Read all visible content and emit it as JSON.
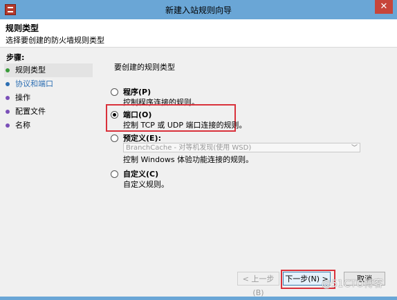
{
  "window": {
    "title": "新建入站规则向导",
    "close_label": "✕"
  },
  "header": {
    "title": "规则类型",
    "subtitle": "选择要创建的防火墙规则类型"
  },
  "sidebar": {
    "title": "步骤:",
    "steps": [
      {
        "label": "规则类型",
        "state": "done"
      },
      {
        "label": "协议和端口",
        "state": "current"
      },
      {
        "label": "操作",
        "state": "todo"
      },
      {
        "label": "配置文件",
        "state": "todo"
      },
      {
        "label": "名称",
        "state": "todo"
      }
    ]
  },
  "main": {
    "question": "要创建的规则类型",
    "options": [
      {
        "label": "程序(P)",
        "desc": "控制程序连接的规则。",
        "selected": false
      },
      {
        "label": "端口(O)",
        "desc": "控制 TCP 或 UDP 端口连接的规则。",
        "selected": true
      },
      {
        "label": "预定义(E):",
        "select_value": "BranchCache - 对等机发现(使用 WSD)",
        "desc": "控制 Windows 体验功能连接的规则。",
        "selected": false
      },
      {
        "label": "自定义(C)",
        "desc": "自定义规则。",
        "selected": false
      }
    ]
  },
  "buttons": {
    "back": "< 上一步(B)",
    "next": "下一步(N) >",
    "cancel": "取消"
  },
  "watermark": "@51CTO博客"
}
